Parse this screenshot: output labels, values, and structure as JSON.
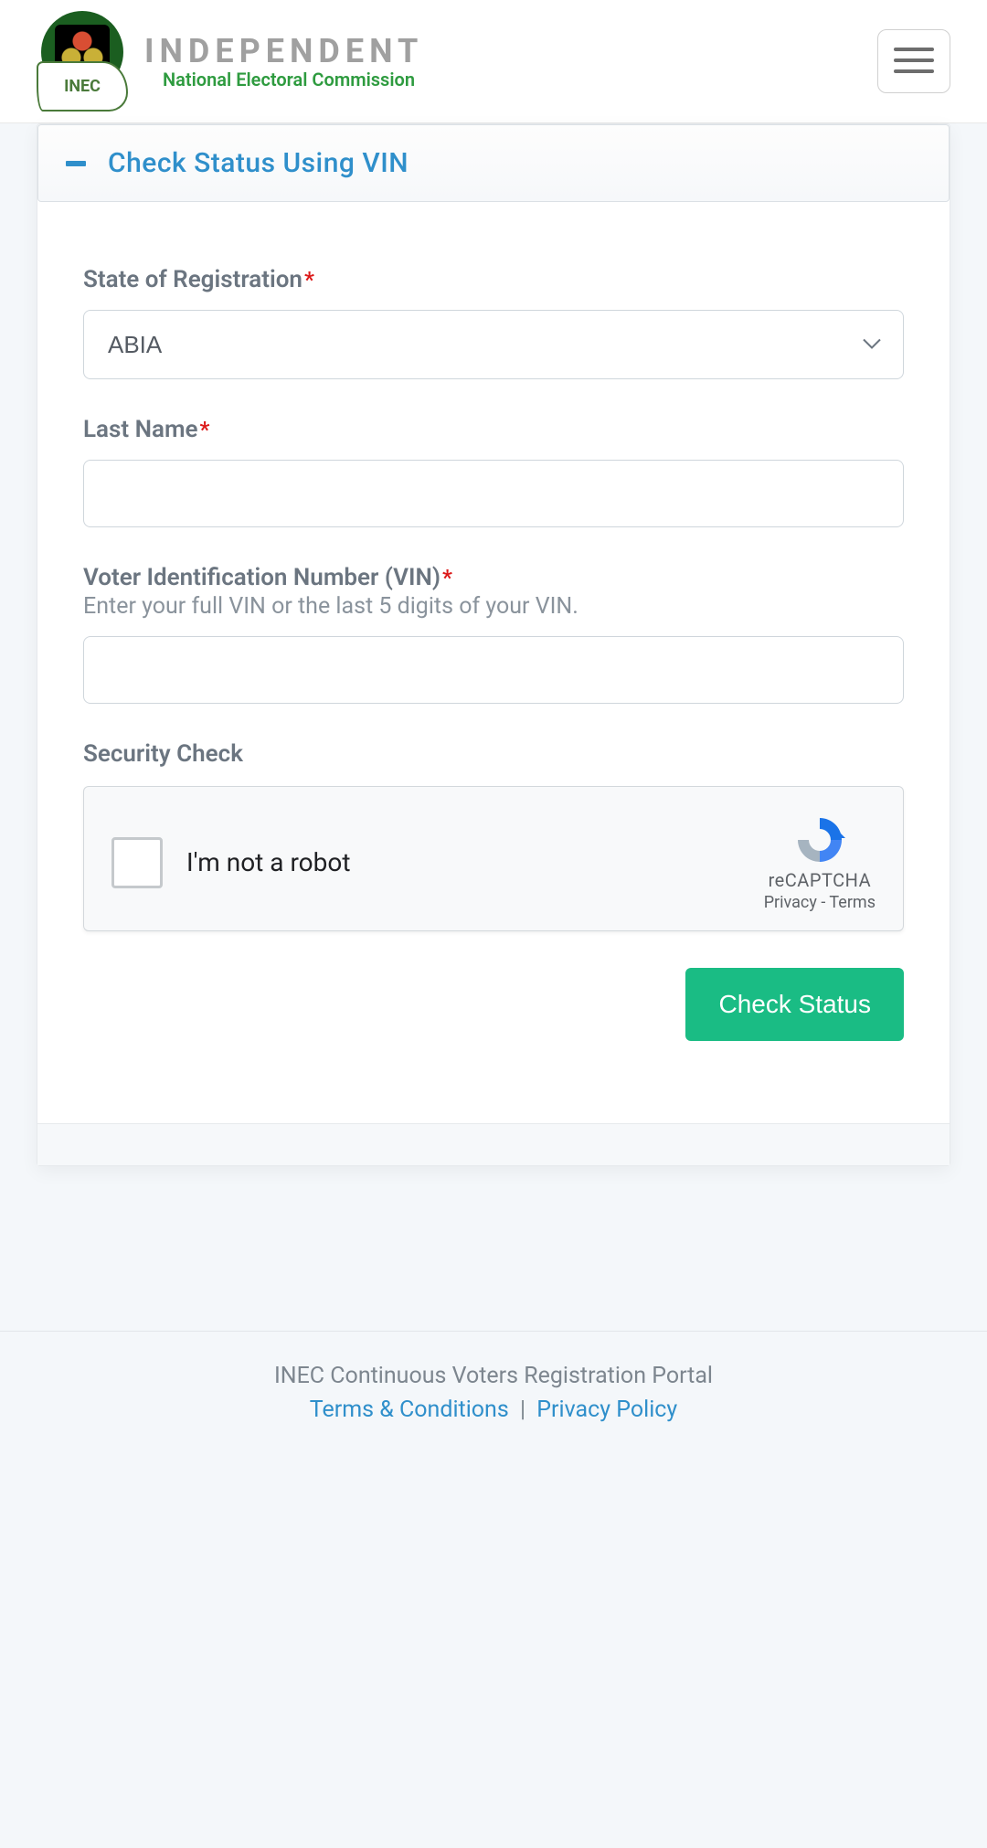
{
  "header": {
    "brand_title": "INDEPENDENT",
    "brand_subtitle": "National Electoral Commission",
    "logo_text": "INEC"
  },
  "accordion": {
    "title": "Check Status Using VIN"
  },
  "form": {
    "state": {
      "label": "State of Registration",
      "selected": "ABIA"
    },
    "last_name": {
      "label": "Last Name",
      "value": ""
    },
    "vin": {
      "label": "Voter Identification Number (VIN)",
      "hint": "Enter your full VIN or the last 5 digits of your VIN.",
      "value": ""
    },
    "security": {
      "label": "Security Check",
      "checkbox_label": "I'm not a robot",
      "brand": "reCAPTCHA",
      "privacy": "Privacy",
      "terms": "Terms"
    },
    "submit_label": "Check Status"
  },
  "footer": {
    "line1": "INEC Continuous Voters Registration Portal",
    "terms": "Terms & Conditions",
    "privacy": "Privacy Policy"
  }
}
